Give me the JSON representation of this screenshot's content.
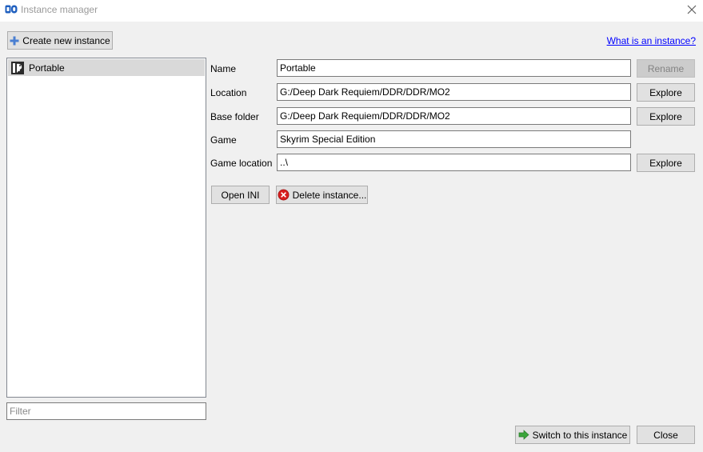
{
  "window": {
    "title": "Instance manager"
  },
  "toolbar": {
    "create_label": "Create new instance",
    "help_link": "What is an instance?"
  },
  "instances": [
    {
      "name": "Portable",
      "selected": true
    }
  ],
  "filter": {
    "placeholder": "Filter",
    "value": ""
  },
  "details": {
    "name_label": "Name",
    "name_value": "Portable",
    "rename_label": "Rename",
    "location_label": "Location",
    "location_value": "G:/Deep Dark Requiem/DDR/DDR/MO2",
    "base_folder_label": "Base folder",
    "base_folder_value": "G:/Deep Dark Requiem/DDR/DDR/MO2",
    "game_label": "Game",
    "game_value": "Skyrim Special Edition",
    "game_location_label": "Game location",
    "game_location_value": "..\\",
    "explore_label": "Explore",
    "open_ini_label": "Open INI",
    "delete_label": "Delete instance..."
  },
  "footer": {
    "switch_label": "Switch to this instance",
    "close_label": "Close"
  },
  "colors": {
    "accent_link": "#0000ff",
    "selection": "#d9d9d9",
    "delete_icon": "#d81e1e",
    "switch_icon": "#3aa53a"
  }
}
